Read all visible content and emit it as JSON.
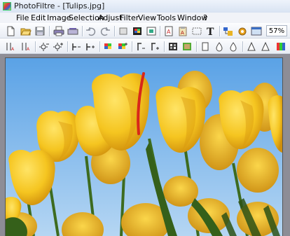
{
  "window": {
    "title": "PhotoFiltre - [Tulips.jpg]",
    "app_icon": "photofiltre-icon"
  },
  "menu": {
    "items": [
      "File",
      "Edit",
      "Image",
      "Selection",
      "Adjust",
      "Filter",
      "View",
      "Tools",
      "Window",
      "?"
    ]
  },
  "toolbar1": {
    "zoom": "57%",
    "icons": [
      "new-icon",
      "open-icon",
      "save-icon",
      "print-icon",
      "scan-icon",
      "undo-icon",
      "redo-icon",
      "crop-icon",
      "duplicate-icon",
      "image-size-icon",
      "canvas-size-icon",
      "paste-icon",
      "text-icon",
      "plugin-icon",
      "automate-icon",
      "fullscreen-icon"
    ]
  },
  "toolbar2": {
    "icons": [
      "auto-levels-icon",
      "auto-contrast-icon",
      "brightness-down-icon",
      "brightness-up-icon",
      "contrast-down-icon",
      "contrast-up-icon",
      "saturation-down-icon",
      "saturation-up-icon",
      "gamma-down-icon",
      "gamma-up-icon",
      "grayscale-icon",
      "sepia-icon",
      "blur-icon",
      "soften-icon",
      "sharpen-icon",
      "sharpen-more-icon",
      "color-balance-icon"
    ]
  },
  "canvas": {
    "image_name": "Tulips.jpg",
    "colors": {
      "sky": "#7fb8e8",
      "petal": "#f5c520",
      "petal_shadow": "#d99a10",
      "stem": "#3d6b1f",
      "streak": "#d8271a"
    }
  }
}
